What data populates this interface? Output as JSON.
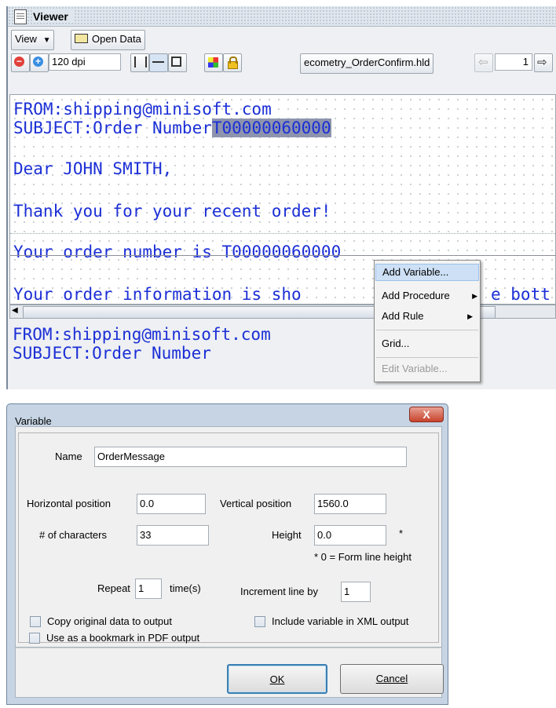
{
  "viewer": {
    "title": "Viewer",
    "toolbar": {
      "view_label": "View",
      "open_data_label": "Open Data",
      "dpi_value": "120 dpi",
      "filename": "ecometry_OrderConfirm.hld",
      "page_value": "1"
    },
    "document": {
      "lines": [
        "FROM:shipping@minisoft.com",
        "SUBJECT:Order Number",
        "Dear JOHN SMITH,",
        "Thank you for your recent order!",
        "Your order number is T00000060000",
        "Your order information is sho",
        "e bott"
      ],
      "selected_text": "T00000060000",
      "lower_lines": [
        "FROM:shipping@minisoft.com",
        "SUBJECT:Order Number"
      ]
    },
    "context_menu": {
      "items": [
        "Add Variable...",
        "Add Procedure",
        "Add Rule",
        "Grid...",
        "Edit Variable..."
      ]
    }
  },
  "dialog": {
    "title": "Variable",
    "close_label": "X",
    "fields": {
      "name_label": "Name",
      "name_value": "OrderMessage",
      "hpos_label": "Horizontal position",
      "hpos_value": "0.0",
      "vpos_label": "Vertical position",
      "vpos_value": "1560.0",
      "chars_label": "# of characters",
      "chars_value": "33",
      "height_label": "Height",
      "height_value": "0.0",
      "height_star": "*",
      "height_note": "* 0 = Form line height",
      "repeat_label": "Repeat",
      "repeat_value": "1",
      "times_label": "time(s)",
      "increment_label": "Increment line by",
      "increment_value": "1"
    },
    "checkboxes": {
      "copy_label": "Copy original data to output",
      "xml_label": "Include variable in XML output",
      "bookmark_label": "Use as a bookmark in PDF output"
    },
    "buttons": {
      "ok_label": "OK",
      "cancel_label": "Cancel"
    }
  }
}
